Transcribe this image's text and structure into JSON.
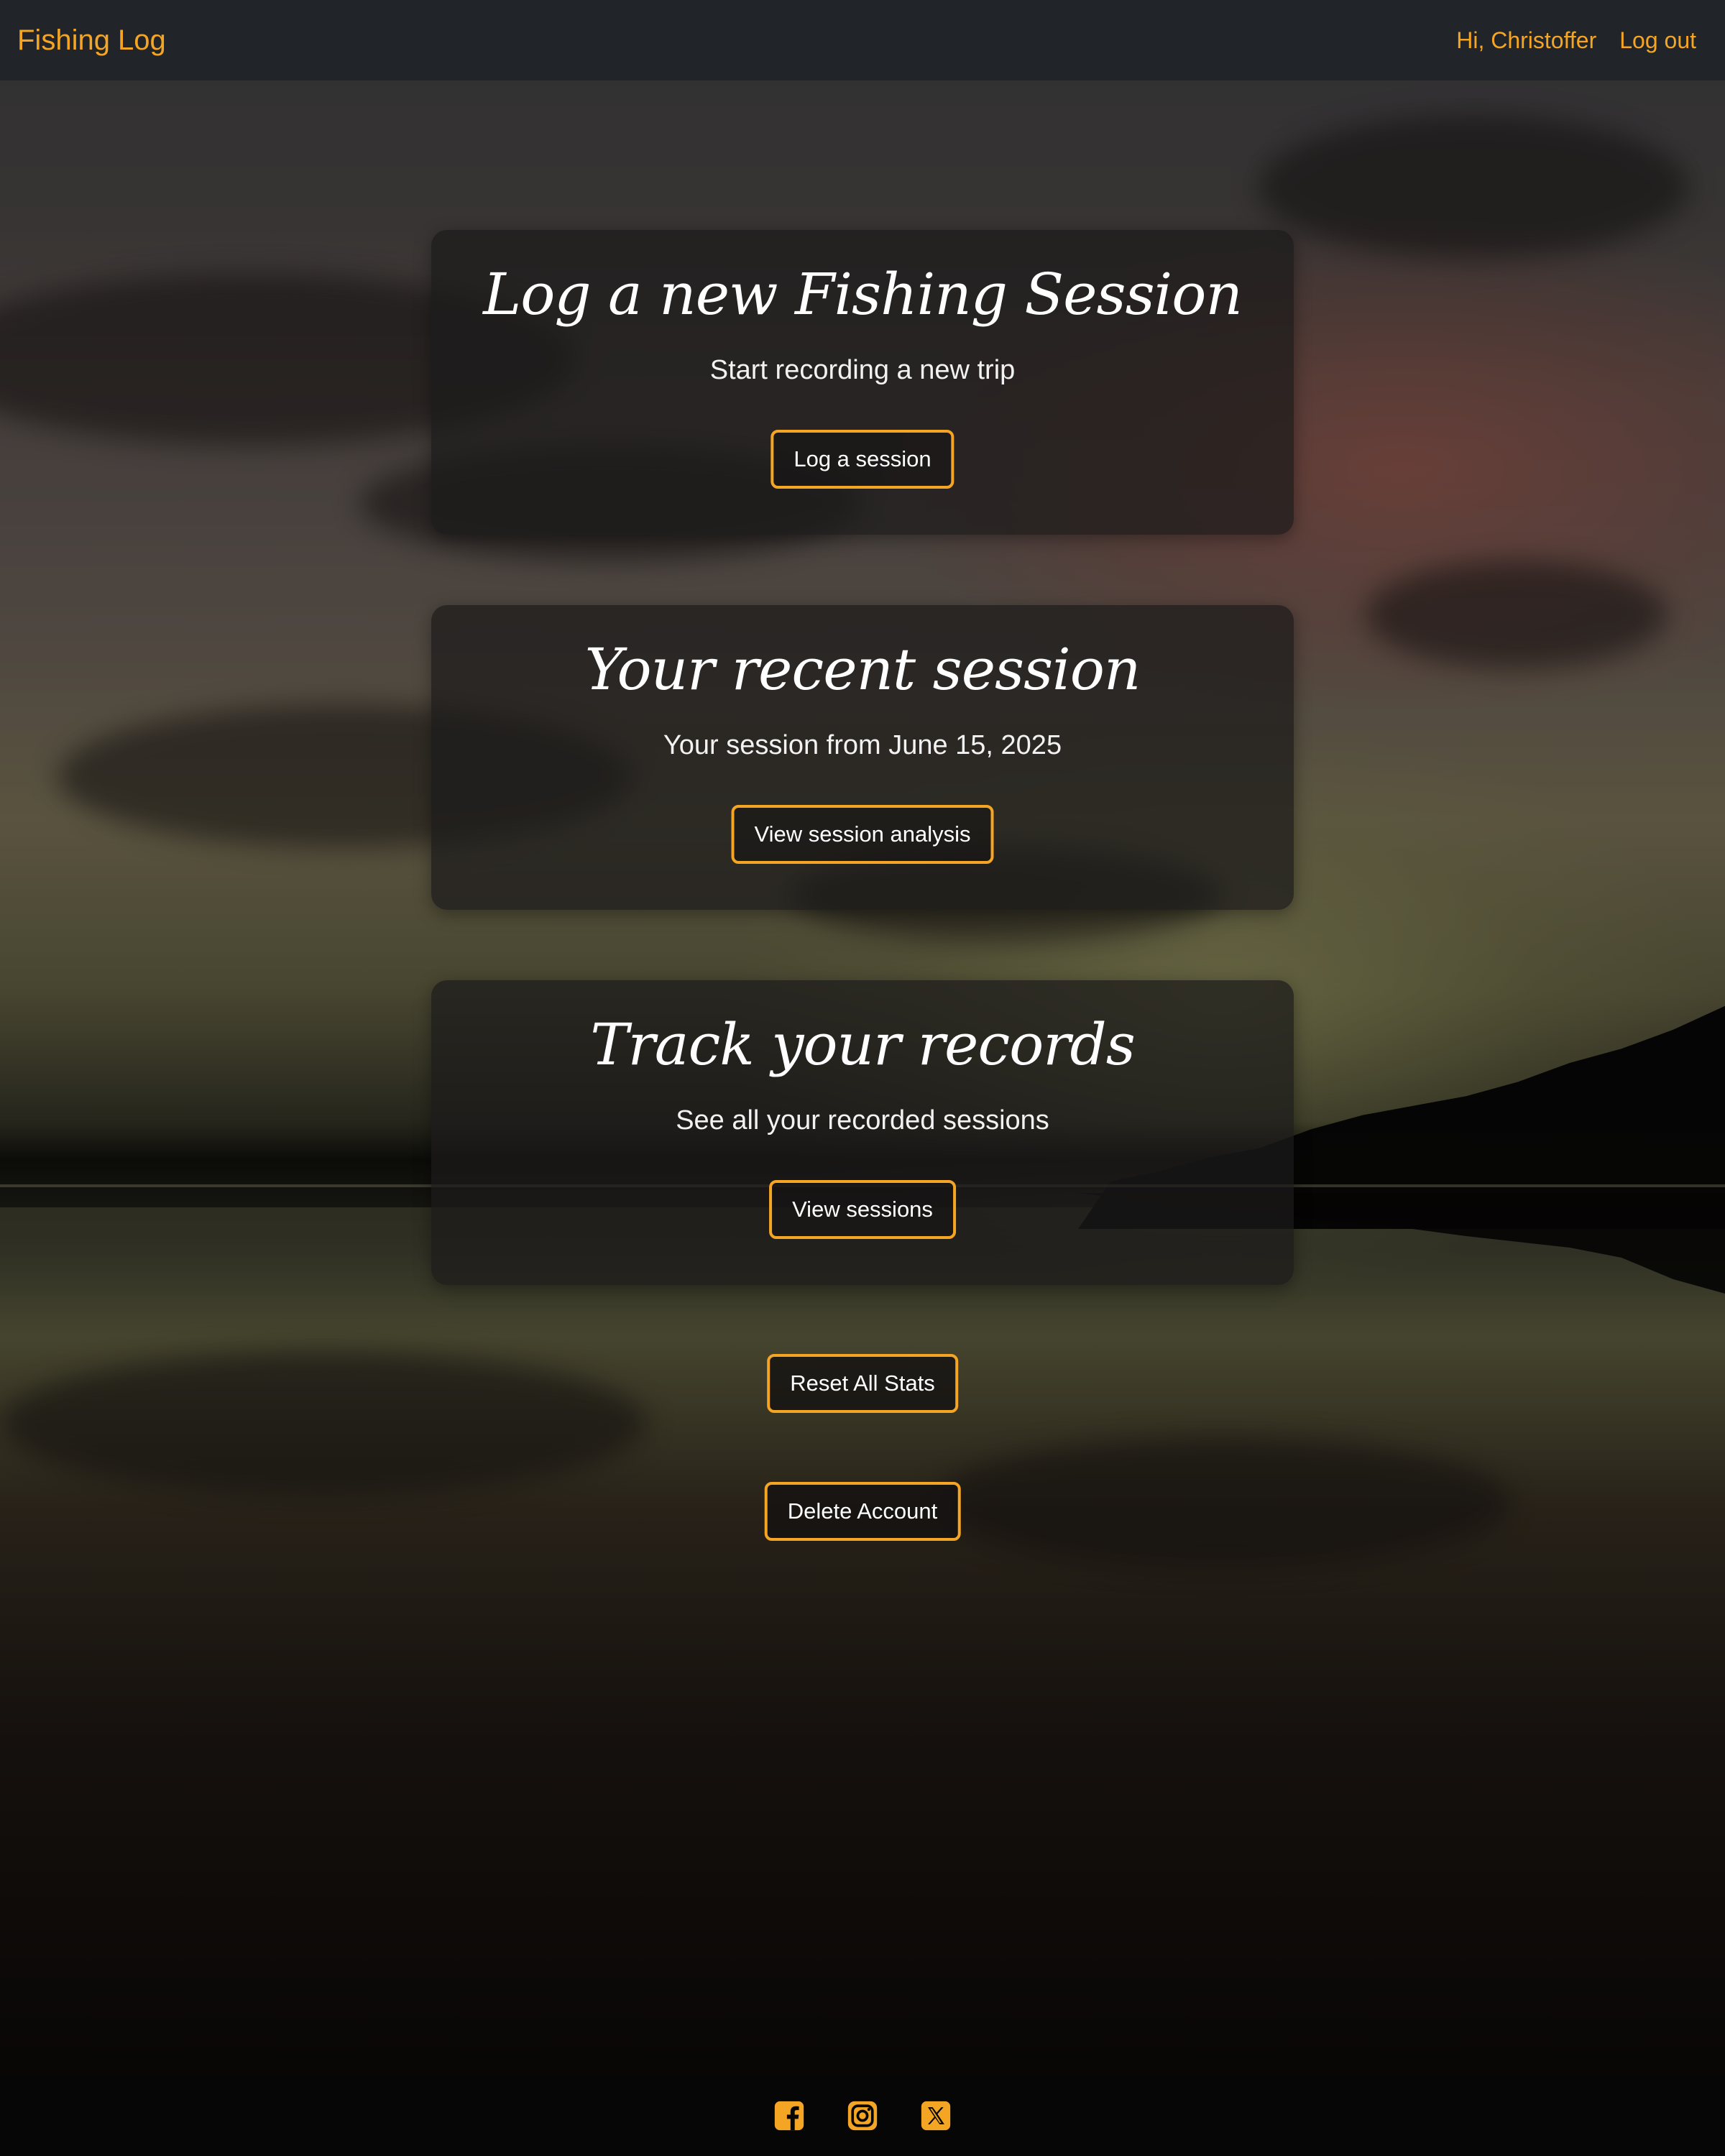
{
  "navbar": {
    "brand": "Fishing Log",
    "greeting": "Hi, Christoffer",
    "logout": "Log out"
  },
  "cards": [
    {
      "title": "Log a new Fishing Session",
      "subtitle": "Start recording a new trip",
      "button": "Log a session"
    },
    {
      "title": "Your recent session",
      "subtitle": "Your session from June 15, 2025",
      "button": "View session analysis"
    },
    {
      "title": "Track your records",
      "subtitle": "See all your recorded sessions",
      "button": "View sessions"
    }
  ],
  "actions": {
    "reset": "Reset All Stats",
    "delete": "Delete Account"
  },
  "footer": {
    "icons": [
      "facebook-icon",
      "instagram-icon",
      "x-twitter-icon"
    ]
  },
  "colors": {
    "accent": "#f5a524",
    "navbar_bg": "#212529",
    "footer_bg": "#060606"
  }
}
